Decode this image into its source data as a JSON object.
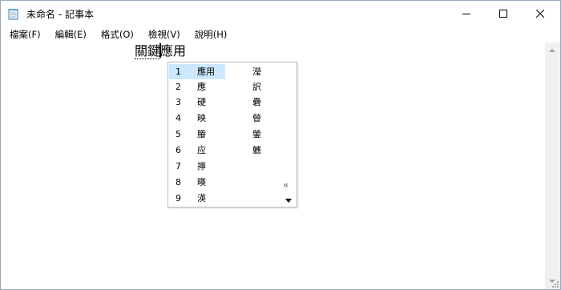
{
  "window": {
    "title": "未命名 - 記事本",
    "controls": {
      "minimize_icon": "minimize-icon",
      "maximize_icon": "maximize-icon",
      "close_icon": "close-icon"
    }
  },
  "menu": [
    {
      "label": "檔案(F)"
    },
    {
      "label": "編輯(E)"
    },
    {
      "label": "格式(O)"
    },
    {
      "label": "檢視(V)"
    },
    {
      "label": "說明(H)"
    }
  ],
  "editor": {
    "committed_text": "關鍵",
    "composing_text": "應用"
  },
  "ime": {
    "candidates": [
      {
        "num": "1",
        "text": "應用"
      },
      {
        "num": "2",
        "text": "應"
      },
      {
        "num": "3",
        "text": "硬"
      },
      {
        "num": "4",
        "text": "映"
      },
      {
        "num": "5",
        "text": "膡"
      },
      {
        "num": "6",
        "text": "应"
      },
      {
        "num": "7",
        "text": "擰"
      },
      {
        "num": "8",
        "text": "暎"
      },
      {
        "num": "9",
        "text": "渶"
      }
    ],
    "selected_index": 0,
    "second_column": [
      "瀅",
      "訳",
      "礨",
      "䁝",
      "鎣",
      "軈"
    ],
    "page_icon": "«",
    "page_down_icon": "page-down-icon"
  },
  "colors": {
    "selection": "#cce8ff",
    "border": "#9aa9bd"
  }
}
